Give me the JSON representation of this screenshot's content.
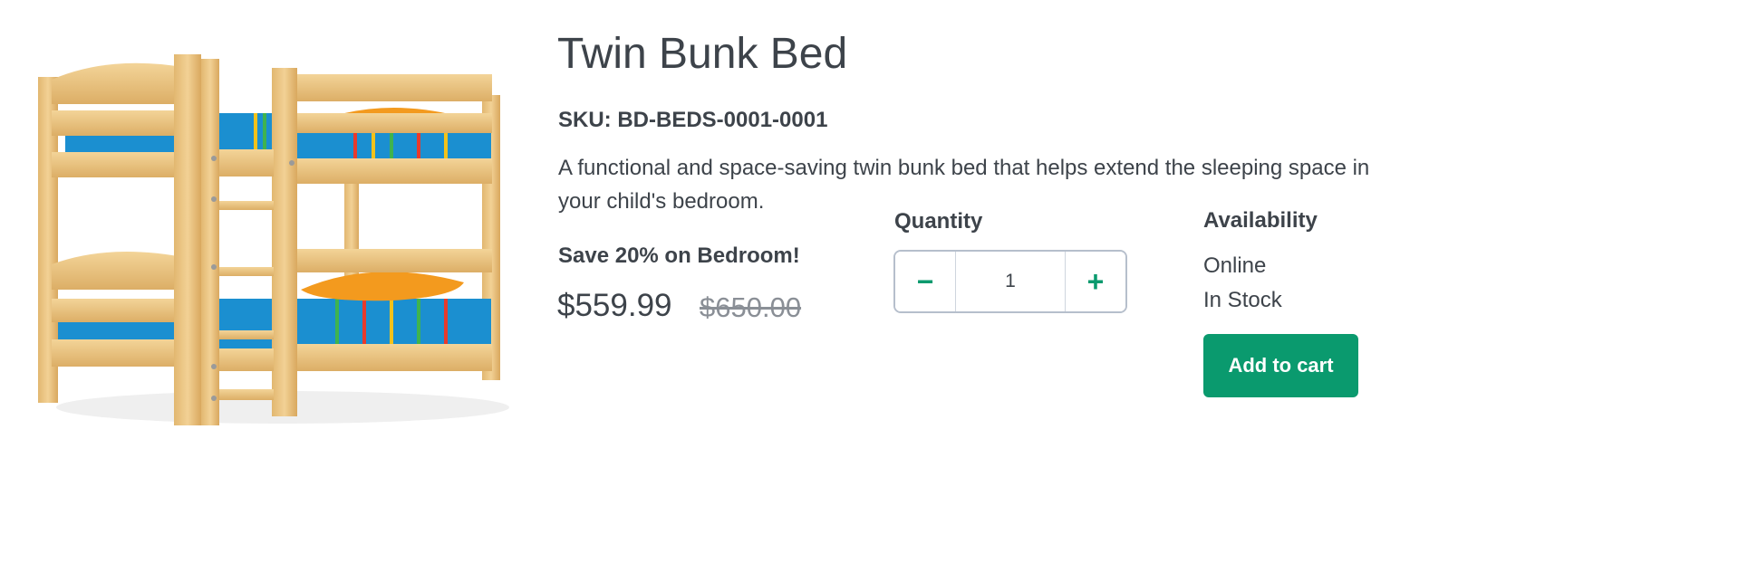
{
  "product": {
    "title": "Twin Bunk Bed",
    "sku": "SKU: BD-BEDS-0001-0001",
    "description": "A functional and space-saving twin bunk bed that helps extend the sleeping space in your child's bedroom.",
    "promo": "Save 20% on Bedroom!",
    "price": "$559.99",
    "original_price": "$650.00"
  },
  "quantity": {
    "label": "Quantity",
    "value": "1",
    "decrement_symbol": "−",
    "increment_symbol": "+"
  },
  "availability": {
    "label": "Availability",
    "channel": "Online",
    "status": "In Stock"
  },
  "actions": {
    "add_to_cart_label": "Add to cart"
  },
  "colors": {
    "accent": "#0a9a6e",
    "text": "#3d434a",
    "muted": "#8a8f96",
    "stepper_border": "#b6bfcc"
  },
  "icons": {
    "product_image": "bunk-bed-image",
    "decrement": "minus-icon",
    "increment": "plus-icon"
  }
}
